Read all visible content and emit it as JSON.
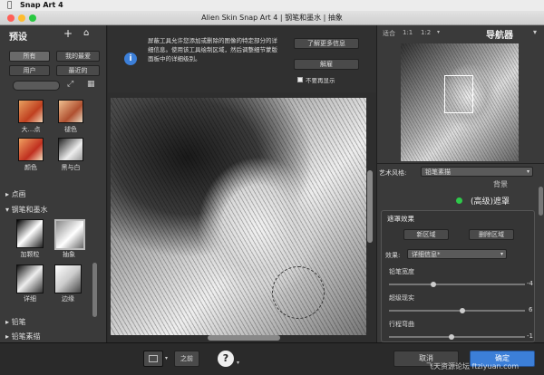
{
  "menubar": {
    "app": "Snap Art 4"
  },
  "window": {
    "title": "Alien Skin Snap Art 4 | 钢笔和墨水 | 抽象"
  },
  "presets": {
    "title": "预设",
    "tabs": [
      "所有",
      "我的最爱",
      "用户",
      "最近的"
    ],
    "thumbs_top": [
      {
        "label": "大…点"
      },
      {
        "label": "褪色"
      },
      {
        "label": "颜色"
      },
      {
        "label": "黑与白"
      }
    ],
    "groups": [
      "点画",
      "钢笔和墨水"
    ],
    "thumbs_pen": [
      {
        "label": "加颗粒"
      },
      {
        "label": "抽象"
      },
      {
        "label": "详细"
      },
      {
        "label": "边缘"
      }
    ],
    "groups_bottom": [
      "铅笔",
      "铅笔素描"
    ]
  },
  "info": {
    "text": "屏蔽工具允许您添加或删除的图像的特定部分的详细信息。使用该工具绘制区域，然后调整细节蒙版面板中的详细级别。",
    "more_btn": "了解更多信息",
    "dismiss_btn": "解雇",
    "noshow": "不要再显示"
  },
  "nav": {
    "fit": "适合",
    "z1": "1:1",
    "z2": "1:2",
    "title": "导航器"
  },
  "right": {
    "style_label": "艺术风格:",
    "style_value": "铅笔素描",
    "bg": "背景",
    "mask_title": "(高级)遮罩",
    "mask_effect": "遮罩效果",
    "new_area": "新区域",
    "del_area": "删除区域",
    "effect_label": "效果:",
    "effect_value": "详细信息*",
    "s1": "铅笔宽度",
    "s1v": "-4",
    "s2": "超级现实",
    "s2v": "6",
    "s3": "行程弯曲",
    "s3v": "-1"
  },
  "bottom": {
    "prev": "之前",
    "cancel": "取消",
    "ok": "确定"
  },
  "watermark": "飞天资源论坛 ftziyuan.com",
  "colors": {
    "accent": "#3c7fd8",
    "green": "#2ec94a"
  }
}
